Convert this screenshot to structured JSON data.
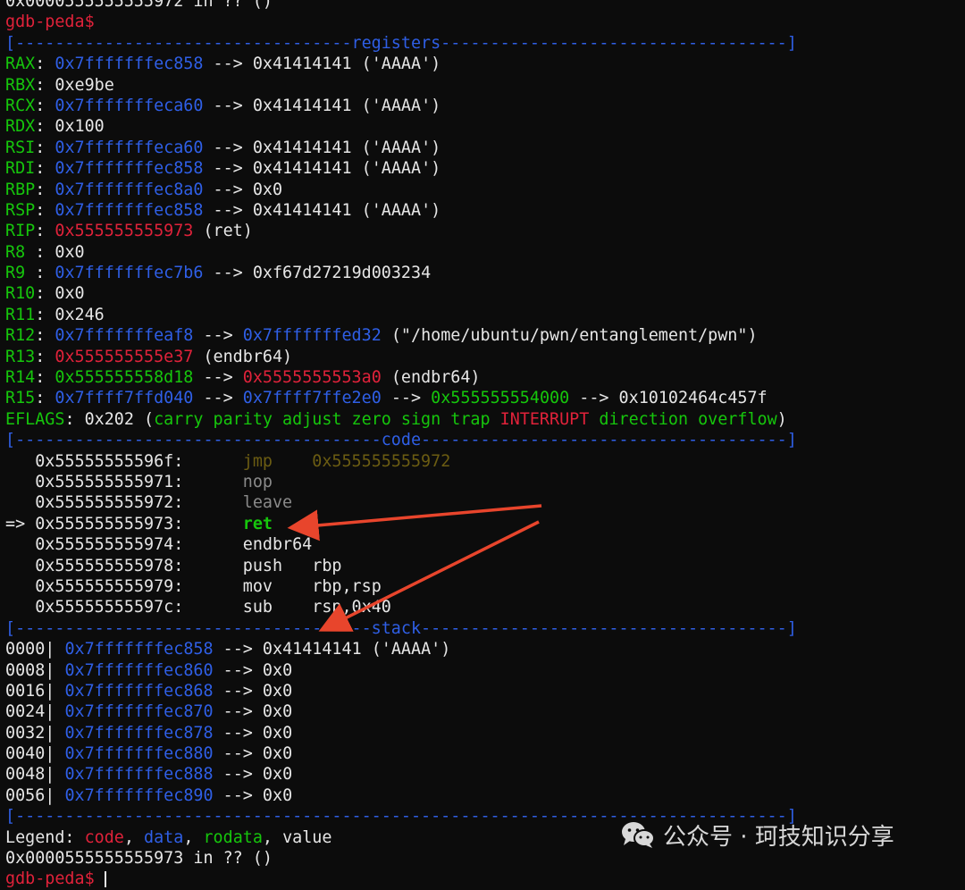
{
  "terminal": {
    "top_partial": "0x0000555555555972 in ?? ()",
    "prompt": "gdb-peda$",
    "sep_registers": "[----------------------------------registers-----------------------------------]",
    "registers": {
      "rax": {
        "label": "RAX",
        "addr": "0x7fffffffec858",
        "arrow": " --> ",
        "val": "0x41414141 ('AAAA')"
      },
      "rbx": {
        "label": "RBX",
        "val": "0xe9be"
      },
      "rcx": {
        "label": "RCX",
        "addr": "0x7fffffffeca60",
        "arrow": " --> ",
        "val": "0x41414141 ('AAAA')"
      },
      "rdx": {
        "label": "RDX",
        "val": "0x100"
      },
      "rsi": {
        "label": "RSI",
        "addr": "0x7fffffffeca60",
        "arrow": " --> ",
        "val": "0x41414141 ('AAAA')"
      },
      "rdi": {
        "label": "RDI",
        "addr": "0x7fffffffec858",
        "arrow": " --> ",
        "val": "0x41414141 ('AAAA')"
      },
      "rbp": {
        "label": "RBP",
        "addr": "0x7fffffffec8a0",
        "arrow": " --> ",
        "val": "0x0"
      },
      "rsp": {
        "label": "RSP",
        "addr": "0x7fffffffec858",
        "arrow": " --> ",
        "val": "0x41414141 ('AAAA')"
      },
      "rip": {
        "label": "RIP",
        "addr": "0x555555555973",
        "val": " (ret)"
      },
      "r8": {
        "label": "R8 ",
        "val": "0x0"
      },
      "r9": {
        "label": "R9 ",
        "addr": "0x7fffffffec7b6",
        "arrow": " --> ",
        "val": "0xf67d27219d003234"
      },
      "r10": {
        "label": "R10",
        "val": "0x0"
      },
      "r11": {
        "label": "R11",
        "val": "0x246"
      },
      "r12": {
        "label": "R12",
        "addr": "0x7fffffffeaf8",
        "arrow": " --> ",
        "addr2": "0x7fffffffed32",
        "val": " (\"/home/ubuntu/pwn/entanglement/pwn\")"
      },
      "r13": {
        "label": "R13",
        "addr": "0x555555555e37",
        "val": " (endbr64)"
      },
      "r14": {
        "label": "R14",
        "addr": "0x555555558d18",
        "arrow": " --> ",
        "addr2": "0x5555555553a0",
        "val": " (endbr64)"
      },
      "r15": {
        "label": "R15",
        "addr": "0x7ffff7ffd040",
        "arrow": " --> ",
        "addr2": "0x7ffff7ffe2e0",
        "arrow2": " --> ",
        "addr3": "0x555555554000",
        "arrow3": " --> ",
        "val": "0x10102464c457f"
      },
      "eflags": {
        "label": "EFLAGS",
        "val": "0x202 (",
        "flags_a": "carry parity adjust zero sign trap ",
        "flag_interrupt": "INTERRUPT",
        "flags_b": " direction overflow",
        "close": ")"
      }
    },
    "sep_code": "[-------------------------------------code-------------------------------------]",
    "code": [
      {
        "marker": "   ",
        "addr": "0x55555555596f:",
        "mnemonic": "jmp    ",
        "operand": "0x555555555972"
      },
      {
        "marker": "   ",
        "addr": "0x555555555971:",
        "mnemonic": "nop",
        "operand": ""
      },
      {
        "marker": "   ",
        "addr": "0x555555555972:",
        "mnemonic": "leave",
        "operand": ""
      },
      {
        "marker": "=> ",
        "addr": "0x555555555973:",
        "mnemonic": "ret",
        "operand": ""
      },
      {
        "marker": "   ",
        "addr": "0x555555555974:",
        "mnemonic": "endbr64",
        "operand": ""
      },
      {
        "marker": "   ",
        "addr": "0x555555555978:",
        "mnemonic": "push   ",
        "operand": "rbp"
      },
      {
        "marker": "   ",
        "addr": "0x555555555979:",
        "mnemonic": "mov    ",
        "operand": "rbp,rsp"
      },
      {
        "marker": "   ",
        "addr": "0x55555555597c:",
        "mnemonic": "sub    ",
        "operand": "rsp,0x40"
      }
    ],
    "sep_stack": "[------------------------------------stack-------------------------------------]",
    "stack": [
      {
        "offset": "0000|",
        "addr": "0x7fffffffec858",
        "arrow": " --> ",
        "val": "0x41414141 ('AAAA')"
      },
      {
        "offset": "0008|",
        "addr": "0x7fffffffec860",
        "arrow": " --> ",
        "val": "0x0"
      },
      {
        "offset": "0016|",
        "addr": "0x7fffffffec868",
        "arrow": " --> ",
        "val": "0x0"
      },
      {
        "offset": "0024|",
        "addr": "0x7fffffffec870",
        "arrow": " --> ",
        "val": "0x0"
      },
      {
        "offset": "0032|",
        "addr": "0x7fffffffec878",
        "arrow": " --> ",
        "val": "0x0"
      },
      {
        "offset": "0040|",
        "addr": "0x7fffffffec880",
        "arrow": " --> ",
        "val": "0x0"
      },
      {
        "offset": "0048|",
        "addr": "0x7fffffffec888",
        "arrow": " --> ",
        "val": "0x0"
      },
      {
        "offset": "0056|",
        "addr": "0x7fffffffec890",
        "arrow": " --> ",
        "val": "0x0"
      }
    ],
    "sep_end": "[------------------------------------------------------------------------------]",
    "legend": {
      "label": "Legend: ",
      "code": "code",
      "comma1": ", ",
      "data": "data",
      "comma2": ", ",
      "rodata": "rodata",
      "comma3": ", ",
      "value": "value"
    },
    "status": "0x0000555555555973 in ?? ()",
    "bottom_prompt": "gdb-peda$ "
  },
  "watermark": {
    "text": "公众号 · 珂技知识分享",
    "icon": "wechat-icon"
  },
  "colors": {
    "background": "#0c0c0c",
    "text": "#e6e6e6",
    "green": "#16c60c",
    "blue": "#2f5fe6",
    "red": "#e0223a",
    "arrow_annotation": "#e8452c"
  }
}
